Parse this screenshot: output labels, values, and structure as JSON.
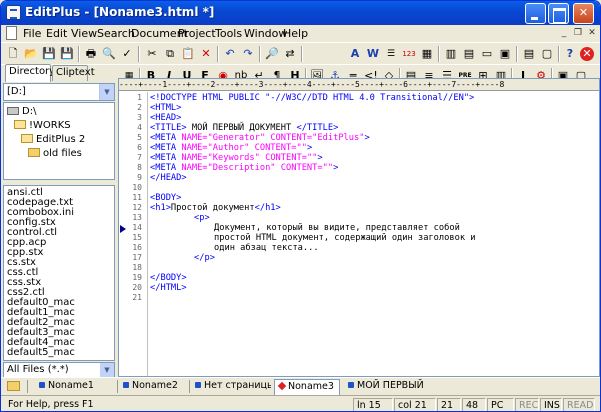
{
  "window": {
    "title": "EditPlus - [Noname3.html *]"
  },
  "menu": [
    "File",
    "Edit",
    "View",
    "Search",
    "Document",
    "Project",
    "Tools",
    "Window",
    "Help"
  ],
  "toolbar_top": {
    "icons": [
      "new-icon",
      "open-icon",
      "save-icon",
      "save-all-icon",
      "print-icon",
      "print-preview-icon",
      "spell-check-icon",
      "cut-icon",
      "copy-icon",
      "paste-icon",
      "delete-icon",
      "undo-icon",
      "redo-icon",
      "find-icon",
      "replace-icon",
      "font-icon",
      "word-wrap-icon",
      "ruler-icon",
      "line-number-icon",
      "dir-window-icon",
      "cliptext-icon",
      "output-window-icon",
      "browser-icon",
      "html-toolbar-icon",
      "help-icon",
      "stop-icon"
    ]
  },
  "toolbar_html": {
    "labels": [
      "B",
      "I",
      "U",
      "F",
      "nb",
      "↵",
      "¶",
      "H",
      "⚓",
      "↵",
      "◇",
      "▤",
      "≡",
      "PRE",
      "⊞",
      "J"
    ]
  },
  "left_panel": {
    "tabs": [
      "Directory",
      "Cliptext"
    ],
    "drive": "[D:]",
    "tree": [
      "D:\\",
      "!WORKS",
      "EditPlus 2",
      "old files"
    ],
    "files": [
      "ansi.ctl",
      "codepage.txt",
      "combobox.ini",
      "config.stx",
      "control.ctl",
      "cpp.acp",
      "cpp.stx",
      "cs.stx",
      "css.ctl",
      "css.stx",
      "css2.ctl",
      "default0_mac",
      "default1_mac",
      "default2_mac",
      "default3_mac",
      "default4_mac",
      "default5_mac"
    ],
    "filter": "All Files (*.*)"
  },
  "editor": {
    "ruler": "----+----1----+----2----+----3----+----4----+----5----+----6----+----7----+----8",
    "line_numbers": [
      "1",
      "2",
      "3",
      "4",
      "5",
      "6",
      "7",
      "8",
      "9",
      "10",
      "11",
      "12",
      "13",
      "14",
      "15",
      "16",
      "17",
      "18",
      "19",
      "20",
      "21"
    ],
    "lines": {
      "l1": "<!DOCTYPE HTML PUBLIC \"-//W3C//DTD HTML 4.0 Transitional//EN\">",
      "l2": "<HTML>",
      "l3": "<HEAD>",
      "l4a": "<TITLE>",
      "l4b": " МОЙ ПЕРВЫЙ ДОКУМЕНТ ",
      "l4c": "</TITLE>",
      "l5a": "<META ",
      "l5b": "NAME=",
      "l5c": "\"Generator\"",
      "l5d": " CONTENT=",
      "l5e": "\"EditPlus\"",
      "l5f": ">",
      "l6a": "<META ",
      "l6b": "NAME=",
      "l6c": "\"Author\"",
      "l6d": " CONTENT=",
      "l6e": "\"\"",
      "l6f": ">",
      "l7a": "<META ",
      "l7b": "NAME=",
      "l7c": "\"Keywords\"",
      "l7d": " CONTENT=",
      "l7e": "\"\"",
      "l7f": ">",
      "l8a": "<META ",
      "l8b": "NAME=",
      "l8c": "\"Description\"",
      "l8d": " CONTENT=",
      "l8e": "\"\"",
      "l8f": ">",
      "l9": "</HEAD>",
      "l11": "<BODY>",
      "l12a": "<h1>",
      "l12b": "Простой документ",
      "l12c": "</h1>",
      "l13": "<p>",
      "l14": "Документ, который вы видите, представляет собой",
      "l15": "простой HTML документ, содержащий один заголовок и",
      "l16": "один абзац текста...",
      "l17": "</p>",
      "l19": "</BODY>",
      "l20": "</HTML>"
    }
  },
  "doc_tabs": [
    {
      "label": "Noname1",
      "color": "blue"
    },
    {
      "label": "Noname2",
      "color": "blue"
    },
    {
      "label": "Нет страницы дл",
      "color": "blue"
    },
    {
      "label": "Noname3",
      "color": "red"
    },
    {
      "label": "МОЙ ПЕРВЫЙ ДОК",
      "color": "blue"
    }
  ],
  "status": {
    "help": "For Help, press F1",
    "line": "ln 15",
    "col": "col 21",
    "n1": "21",
    "n2": "48",
    "mode": "PC",
    "rec": "REC",
    "ins": "INS",
    "read": "READ"
  },
  "colors": {
    "tag": "#0000ff",
    "attr": "#ff00ff",
    "title_bar": "#0a5ee6"
  }
}
